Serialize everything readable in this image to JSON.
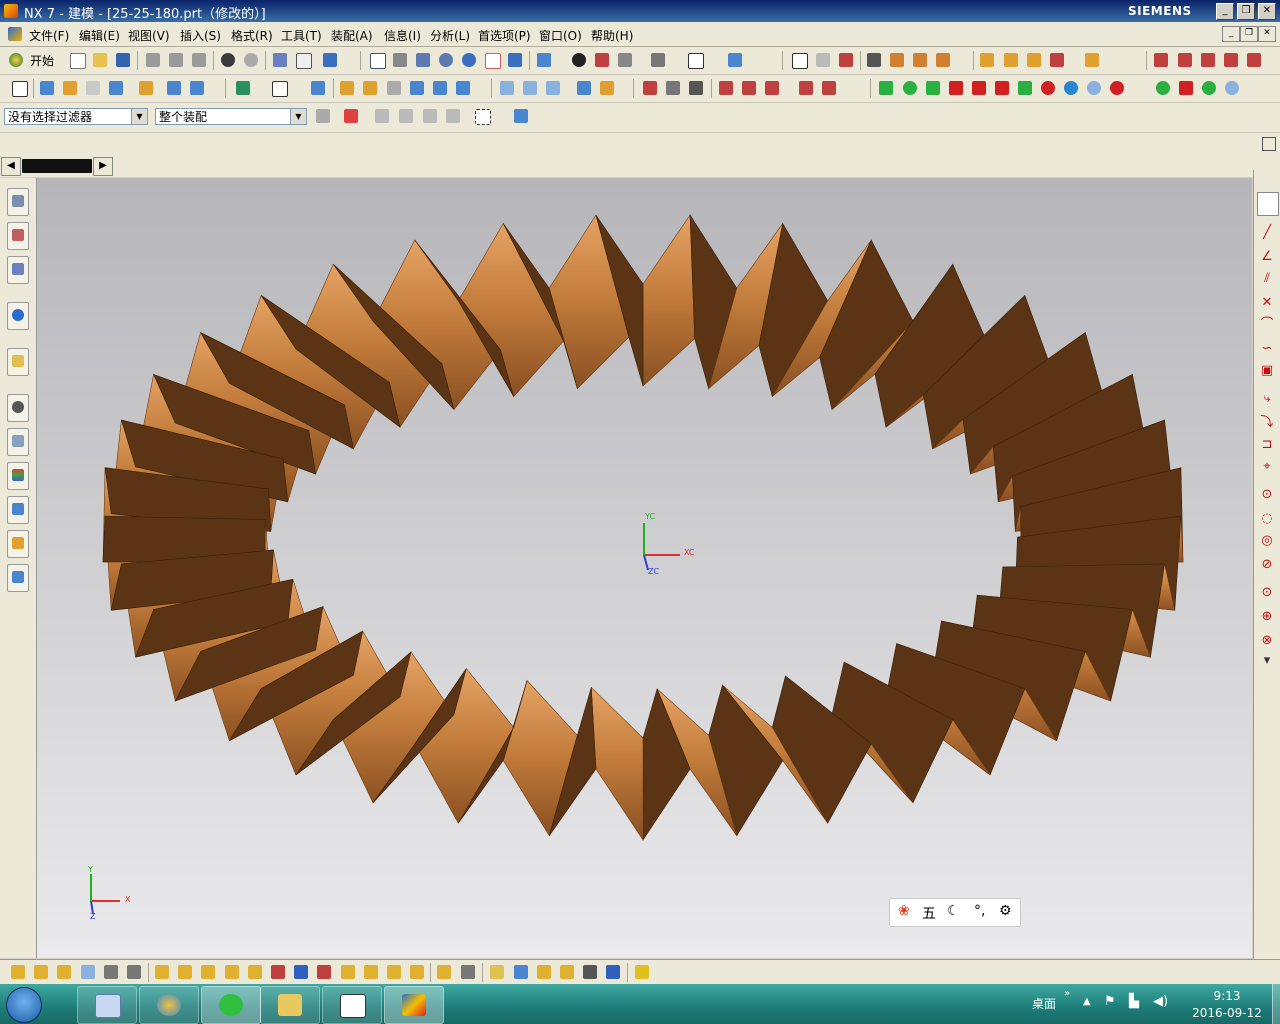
{
  "window": {
    "title": "NX 7 - 建模 - [25-25-180.prt（修改的）]",
    "brand": "SIEMENS"
  },
  "menu": [
    "文件(F)",
    "编辑(E)",
    "视图(V)",
    "插入(S)",
    "格式(R)",
    "工具(T)",
    "装配(A)",
    "信息(I)",
    "分析(L)",
    "首选项(P)",
    "窗口(O)",
    "帮助(H)"
  ],
  "toolbar": {
    "start_label": "开始"
  },
  "filters": {
    "selection_filter": "没有选择过滤器",
    "scope": "整个装配"
  },
  "viewport": {
    "wcs": {
      "x": "XC",
      "y": "YC",
      "z": "ZC"
    },
    "abs": {
      "x": "X",
      "y": "Y",
      "z": "Z"
    },
    "part_color": "#c07a3a",
    "gear_teeth": 36
  },
  "ime": {
    "char": "五"
  },
  "taskbar": {
    "desktop_label": "桌面",
    "time": "9:13",
    "date": "2016-09-12"
  }
}
